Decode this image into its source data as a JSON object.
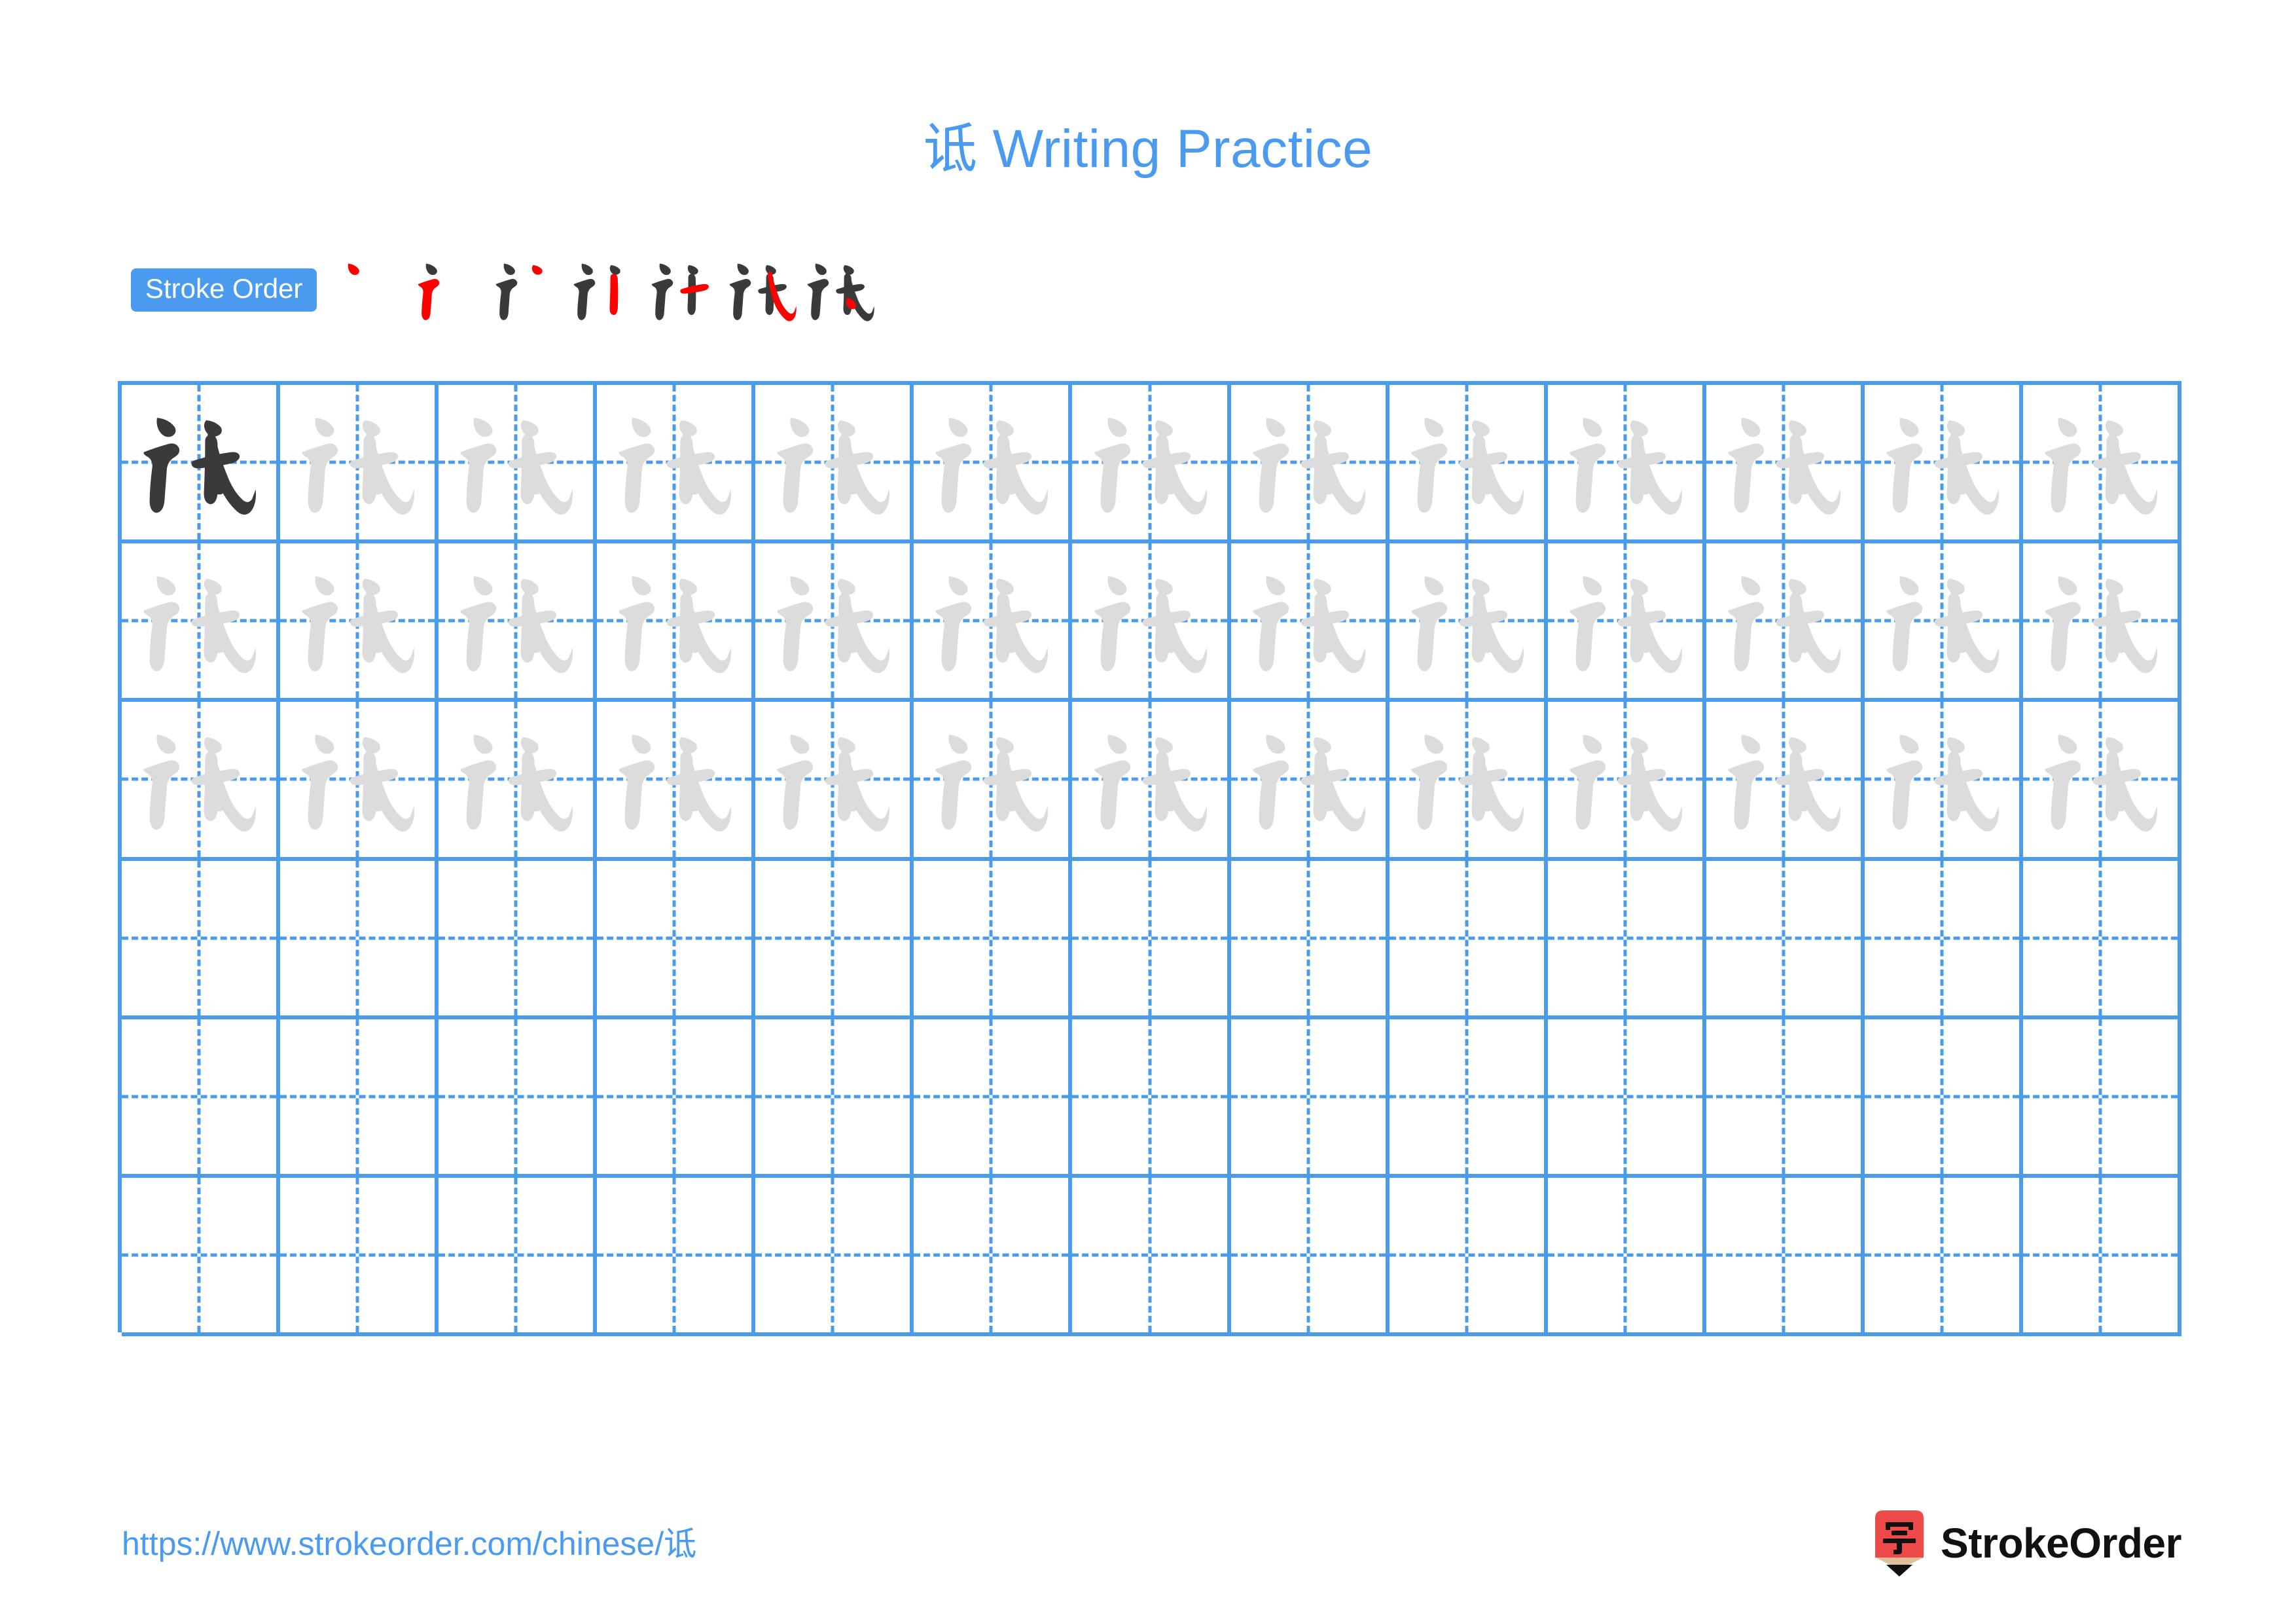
{
  "page": {
    "character": "诋",
    "title": "诋 Writing Practice",
    "background_color": "#ffffff",
    "accent_color": "#4a9bf0",
    "grid_line_color": "#4a9ceb",
    "trace_color": "#dcdcdc",
    "ink_color": "#3a3a3a",
    "highlight_color": "#ff0000"
  },
  "stroke_order": {
    "badge_label": "Stroke Order",
    "total_strokes": 7,
    "steps": [
      {
        "index": 1,
        "label": "诋 stroke 1",
        "new_stroke": "dot"
      },
      {
        "index": 2,
        "label": "诋 stroke 2",
        "new_stroke": "horizontal-fold-tick"
      },
      {
        "index": 3,
        "label": "诋 stroke 3",
        "new_stroke": "slanted-stroke"
      },
      {
        "index": 4,
        "label": "诋 stroke 4",
        "new_stroke": "vertical"
      },
      {
        "index": 5,
        "label": "诋 stroke 5",
        "new_stroke": "horizontal"
      },
      {
        "index": 6,
        "label": "诋 stroke 6",
        "new_stroke": "slanted-hook"
      },
      {
        "index": 7,
        "label": "诋 stroke 7",
        "new_stroke": "dot"
      }
    ]
  },
  "practice_grid": {
    "columns": 13,
    "rows": 6,
    "cells": [
      [
        "ink",
        "trace",
        "trace",
        "trace",
        "trace",
        "trace",
        "trace",
        "trace",
        "trace",
        "trace",
        "trace",
        "trace",
        "trace"
      ],
      [
        "trace",
        "trace",
        "trace",
        "trace",
        "trace",
        "trace",
        "trace",
        "trace",
        "trace",
        "trace",
        "trace",
        "trace",
        "trace"
      ],
      [
        "trace",
        "trace",
        "trace",
        "trace",
        "trace",
        "trace",
        "trace",
        "trace",
        "trace",
        "trace",
        "trace",
        "trace",
        "trace"
      ],
      [
        "empty",
        "empty",
        "empty",
        "empty",
        "empty",
        "empty",
        "empty",
        "empty",
        "empty",
        "empty",
        "empty",
        "empty",
        "empty"
      ],
      [
        "empty",
        "empty",
        "empty",
        "empty",
        "empty",
        "empty",
        "empty",
        "empty",
        "empty",
        "empty",
        "empty",
        "empty",
        "empty"
      ],
      [
        "empty",
        "empty",
        "empty",
        "empty",
        "empty",
        "empty",
        "empty",
        "empty",
        "empty",
        "empty",
        "empty",
        "empty",
        "empty"
      ]
    ]
  },
  "footer": {
    "url": "https://www.strokeorder.com/chinese/诋",
    "brand_name": "StrokeOrder",
    "logo_character": "字",
    "logo_body_color": "#ef4a4a",
    "logo_wood_color": "#e0c09a",
    "logo_tip_color": "#111111"
  }
}
